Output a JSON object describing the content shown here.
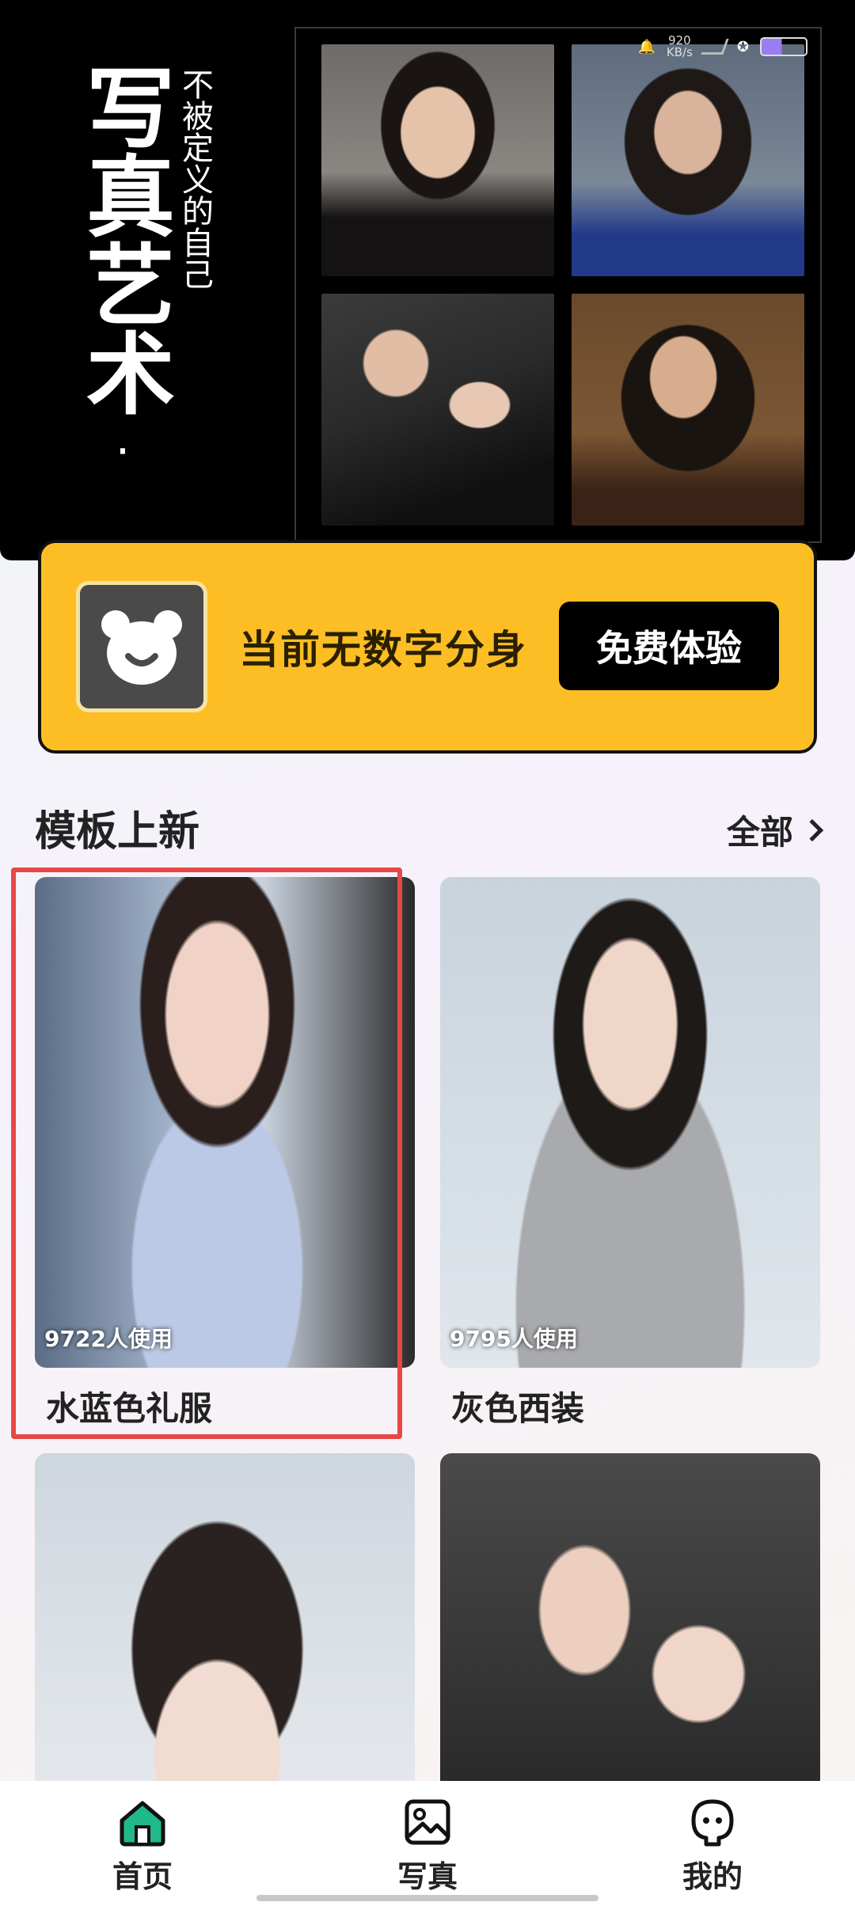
{
  "status_bar": {
    "speed_value": "920",
    "speed_unit": "KB/s"
  },
  "banner": {
    "title": "写真艺术",
    "dot": "·",
    "subtitle": "不被定义的自己"
  },
  "avatar_card": {
    "message": "当前无数字分身",
    "cta_label": "免费体验"
  },
  "section": {
    "title": "模板上新",
    "all_label": "全部"
  },
  "templates": [
    {
      "name": "水蓝色礼服",
      "uses": "9722人使用"
    },
    {
      "name": "灰色西装",
      "uses": "9795人使用"
    },
    {
      "name": "",
      "uses": ""
    },
    {
      "name": "",
      "uses": ""
    }
  ],
  "tabbar": {
    "items": [
      {
        "label": "首页",
        "icon": "home-icon",
        "active": true
      },
      {
        "label": "写真",
        "icon": "image-icon",
        "active": false
      },
      {
        "label": "我的",
        "icon": "profile-icon",
        "active": false
      }
    ]
  },
  "colors": {
    "accent_yellow": "#fdbe25",
    "highlight_red": "#e84747",
    "active_tab": "#1fb98a"
  }
}
